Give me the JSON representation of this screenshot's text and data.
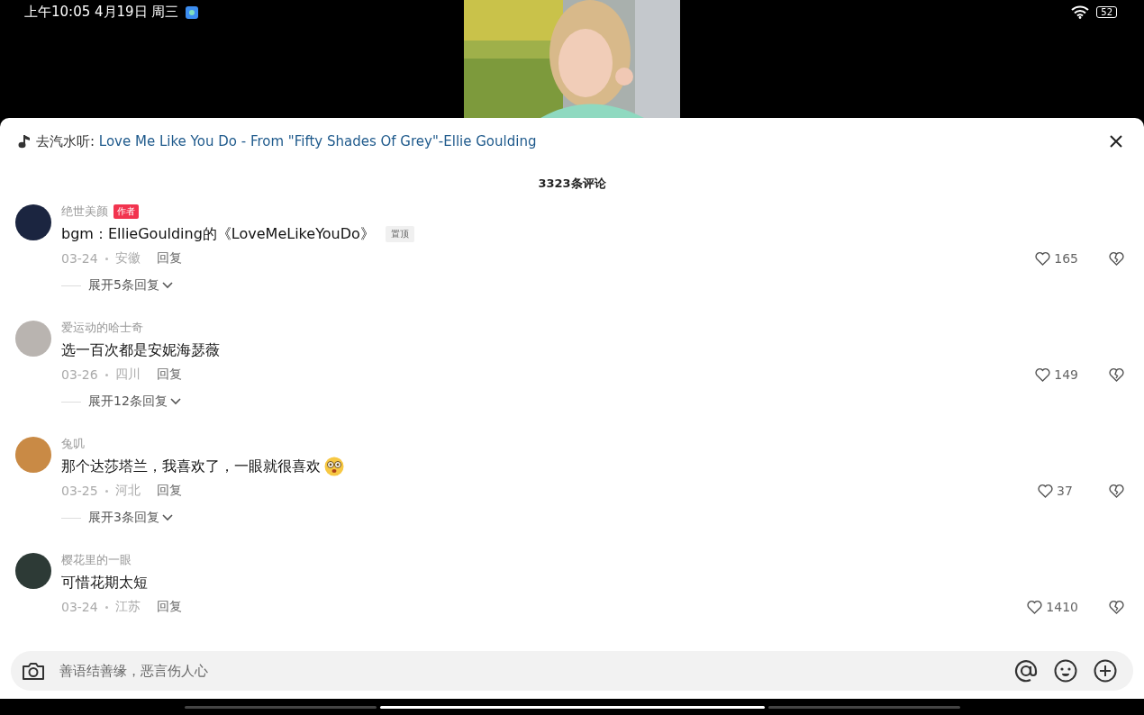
{
  "status_bar": {
    "time": "上午10:05 4月19日 周三",
    "battery": "52"
  },
  "music_banner": {
    "prefix": "去汽水听: ",
    "song": "Love Me Like You Do - From \"Fifty Shades Of Grey\"-Ellie Goulding"
  },
  "comment_count": "3323条评论",
  "comments": [
    {
      "color": "#1b2540",
      "name": "绝世美颜",
      "badge": "作者",
      "text": "bgm：EllieGoulding的《LoveMeLikeYouDo》",
      "tag": "置顶",
      "emoji": false,
      "date": "03-24",
      "location": "安徽",
      "reply": "回复",
      "likes": "165",
      "expand": "展开5条回复"
    },
    {
      "color": "#b9b4b0",
      "name": "爱运动的哈士奇",
      "text": "选一百次都是安妮海瑟薇",
      "emoji": false,
      "date": "03-26",
      "location": "四川",
      "reply": "回复",
      "likes": "149",
      "expand": "展开12条回复"
    },
    {
      "color": "#c98a45",
      "name": "兔叽",
      "text": "那个达莎塔兰，我喜欢了，一眼就很喜欢",
      "emoji": true,
      "date": "03-25",
      "location": "河北",
      "reply": "回复",
      "likes": "37",
      "expand": "展开3条回复"
    },
    {
      "color": "#2d3a36",
      "name": "樱花里的一眼",
      "text": "可惜花期太短",
      "emoji": false,
      "date": "03-24",
      "location": "江苏",
      "reply": "回复",
      "likes": "1410"
    }
  ],
  "input": {
    "placeholder": "善语结善缘，恶言伤人心"
  }
}
